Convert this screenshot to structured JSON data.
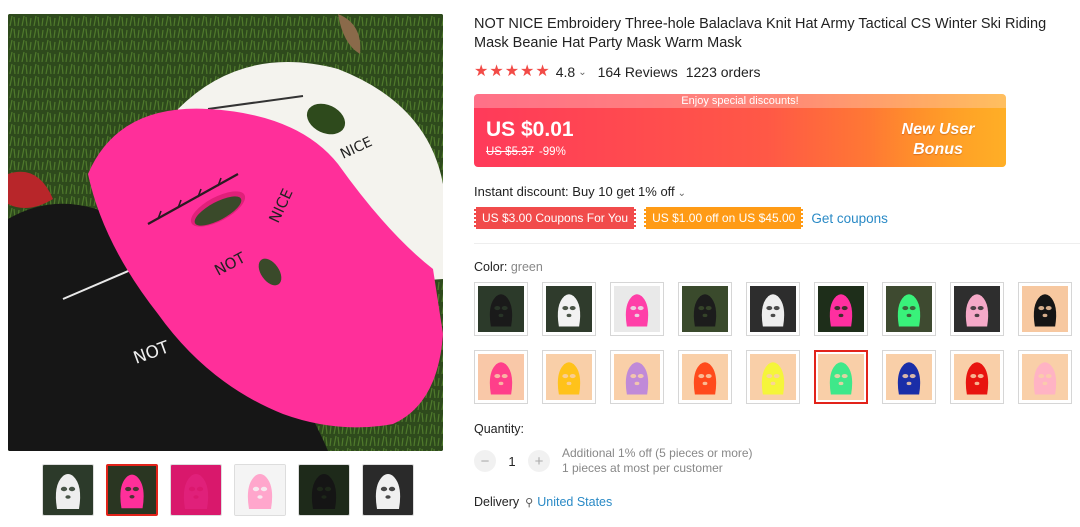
{
  "product": {
    "title": "NOT NICE Embroidery Three-hole Balaclava Knit Hat Army Tactical CS Winter Ski Riding Mask Beanie Hat Party Mask Warm Mask",
    "rating": "4.8",
    "reviews": "164 Reviews",
    "orders": "1223 orders"
  },
  "price": {
    "banner_text": "Enjoy special discounts!",
    "current": "US $0.01",
    "original": "US $5.37",
    "discount": "-99%",
    "bonus_line1": "New User",
    "bonus_line2": "Bonus"
  },
  "instant_discount": "Instant discount: Buy 10 get 1% off",
  "coupons": [
    {
      "label": "US $3.00 Coupons For You",
      "color": "#f14b4b"
    },
    {
      "label": "US $1.00 off on US $45.00",
      "color": "#ff9b16"
    }
  ],
  "get_coupons": "Get coupons",
  "color": {
    "label": "Color:",
    "value": "green",
    "swatches": [
      {
        "name": "black",
        "hex": "#1a1a1a",
        "bg": "#2c3a2a"
      },
      {
        "name": "white",
        "hex": "#f2f2f2",
        "bg": "#2f3b2c"
      },
      {
        "name": "rose",
        "hex": "#ff3fa8",
        "bg": "#e9e9e9"
      },
      {
        "name": "black-embroidery",
        "hex": "#1c1c1c",
        "bg": "#3a4a2c"
      },
      {
        "name": "white-embroidery",
        "hex": "#eeeeee",
        "bg": "#2d2d2d"
      },
      {
        "name": "rose-embroidery",
        "hex": "#ff2fa0",
        "bg": "#1e2e1a"
      },
      {
        "name": "fluorescent-green",
        "hex": "#39f27a",
        "bg": "#3e4a30"
      },
      {
        "name": "pink",
        "hex": "#f5a9c8",
        "bg": "#2e2e2e"
      },
      {
        "name": "black-plain",
        "hex": "#151515",
        "bg": "#f7c8a0"
      },
      {
        "name": "hot-pink",
        "hex": "#ff3f8a",
        "bg": "#f9c8a8"
      },
      {
        "name": "yellow",
        "hex": "#ffc21a",
        "bg": "#f9cfa8"
      },
      {
        "name": "purple",
        "hex": "#c08ad8",
        "bg": "#f9cfa8"
      },
      {
        "name": "orange",
        "hex": "#ff4a1c",
        "bg": "#f9cfa8"
      },
      {
        "name": "lemon",
        "hex": "#f5f53a",
        "bg": "#f9cfa8"
      },
      {
        "name": "green",
        "hex": "#3fe88a",
        "bg": "#f9cfa8"
      },
      {
        "name": "navy",
        "hex": "#1a2ea8",
        "bg": "#f9cfa8"
      },
      {
        "name": "red",
        "hex": "#e8140f",
        "bg": "#f9cfa8"
      },
      {
        "name": "light-pink",
        "hex": "#ffb3c4",
        "bg": "#f9cfa8"
      }
    ],
    "selected_index": 14
  },
  "quantity": {
    "label": "Quantity:",
    "value": "1",
    "minus": "−",
    "plus": "+",
    "info_line1": "Additional 1% off (5 pieces or more)",
    "info_line2": "1 pieces at most per customer"
  },
  "delivery": {
    "label": "Delivery",
    "country": "United States"
  },
  "gallery": {
    "thumbnails": [
      {
        "name": "mixed",
        "hex": "#eeeeee",
        "bg": "#2c3a2a"
      },
      {
        "name": "rose-white-black",
        "hex": "#ff2f9a",
        "bg": "#2a3622"
      },
      {
        "name": "rose-flat",
        "hex": "#e0207a",
        "bg": "#d9186c"
      },
      {
        "name": "pink-model",
        "hex": "#ffa6cc",
        "bg": "#f4f4f4"
      },
      {
        "name": "black-flat",
        "hex": "#151515",
        "bg": "#1e2a1a"
      },
      {
        "name": "white-flat",
        "hex": "#f0f0f0",
        "bg": "#2a2a2a"
      }
    ],
    "active_index": 1,
    "main_embroidery_1": "NOT",
    "main_embroidery_2": "NICE"
  }
}
